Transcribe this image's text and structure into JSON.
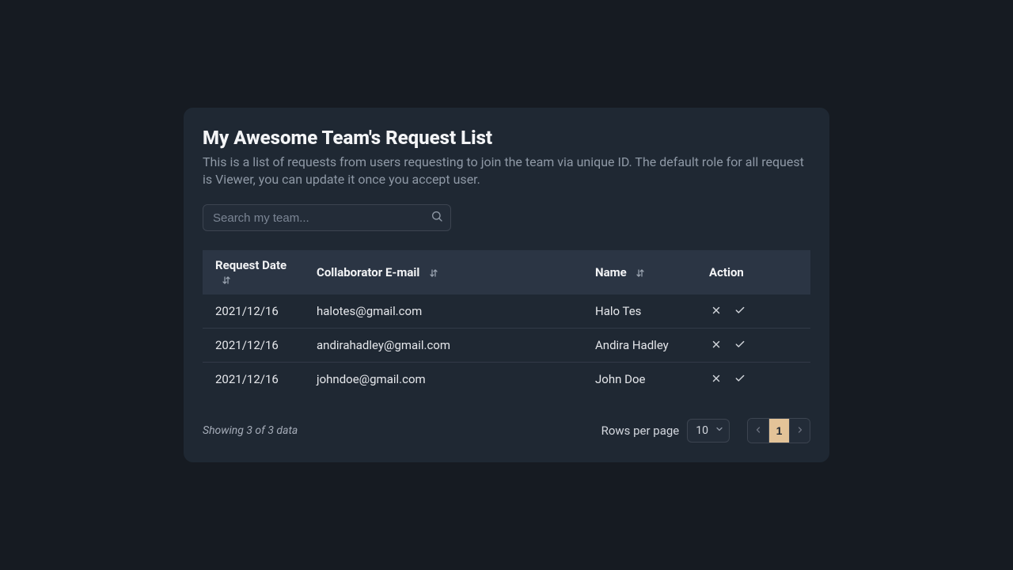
{
  "card": {
    "title": "My Awesome Team's Request List",
    "description": "This is a list of requests from users requesting to join the team via unique ID. The default role for all request is Viewer, you can update it once you accept user."
  },
  "search": {
    "placeholder": "Search my team...",
    "value": ""
  },
  "table": {
    "columns": {
      "date": "Request Date",
      "email": "Collaborator E-mail",
      "name": "Name",
      "action": "Action"
    },
    "rows": [
      {
        "date": "2021/12/16",
        "email": "halotes@gmail.com",
        "name": "Halo Tes"
      },
      {
        "date": "2021/12/16",
        "email": "andirahadley@gmail.com",
        "name": "Andira Hadley"
      },
      {
        "date": "2021/12/16",
        "email": "johndoe@gmail.com",
        "name": "John Doe"
      }
    ]
  },
  "footer": {
    "showing": "Showing 3 of 3 data",
    "rows_per_page_label": "Rows per page",
    "rows_per_page_value": "10",
    "page_current": "1"
  }
}
